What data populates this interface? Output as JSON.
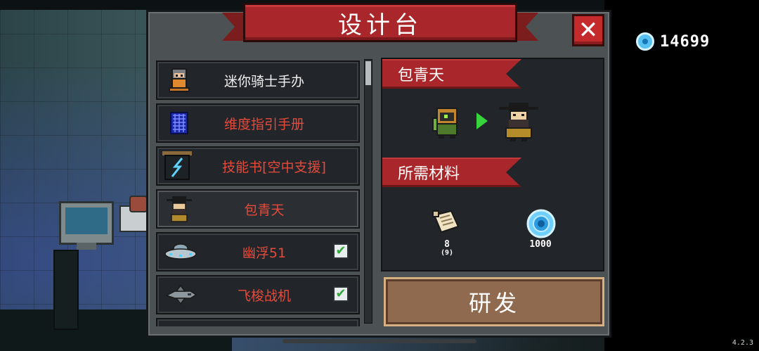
{
  "title": "设计台",
  "gems": "14699",
  "version": "4.2.3",
  "list": {
    "items": [
      {
        "label": "迷你骑士手办",
        "color": "white",
        "checked": false,
        "icon": "mini-knight-figure-icon"
      },
      {
        "label": "维度指引手册",
        "color": "red",
        "checked": false,
        "icon": "dimension-guide-book-icon"
      },
      {
        "label": "技能书[空中支援]",
        "color": "red",
        "checked": false,
        "icon": "skill-book-air-support-icon"
      },
      {
        "label": "包青天",
        "color": "red",
        "checked": false,
        "icon": "bao-qingtian-icon",
        "selected": true
      },
      {
        "label": "幽浮51",
        "color": "red",
        "checked": true,
        "icon": "ufo-icon"
      },
      {
        "label": "飞梭战机",
        "color": "red",
        "checked": true,
        "icon": "shuttle-fighter-icon"
      }
    ]
  },
  "detail": {
    "name": "包青天",
    "materials_title": "所需材料",
    "materials": [
      {
        "icon": "parchment-icon",
        "amount": "8",
        "owned": "(9)"
      },
      {
        "icon": "gem-icon",
        "amount": "1000"
      }
    ]
  },
  "research_button": "研发",
  "colors": {
    "accent_red": "#a9262a",
    "panel": "#4c5253",
    "list_bg": "#22262a",
    "button_brown": "#8f6a4f",
    "check_green": "#32a93a",
    "gem_blue": "#57c2f1"
  }
}
